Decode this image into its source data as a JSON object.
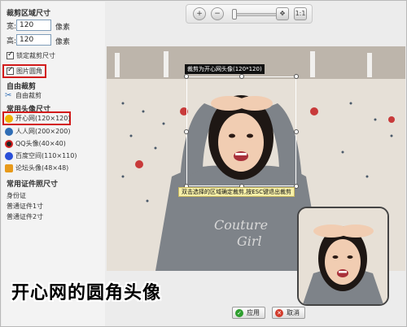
{
  "sidebar": {
    "crop_size_title": "裁剪区域尺寸",
    "width_label": "宽:",
    "width_value": "120",
    "width_unit": "像素",
    "height_label": "高:",
    "height_value": "120",
    "height_unit": "像素",
    "lock_size_label": "锁定裁剪尺寸",
    "rounded_corner_label": "图片圆角",
    "free_crop_title": "自由裁剪",
    "free_crop_item": "自由裁剪",
    "common_avatar_title": "常用头像尺寸",
    "avatar_items": [
      {
        "label": "开心网(120×120)",
        "icon": "kaixin-icon",
        "color": "#e8a400"
      },
      {
        "label": "人人网(200×200)",
        "icon": "renren-icon",
        "color": "#2f6db5"
      },
      {
        "label": "QQ头像(40×40)",
        "icon": "qq-penguin-icon",
        "color": "#d61f1f"
      },
      {
        "label": "百度空间(110×110)",
        "icon": "baidu-paw-icon",
        "color": "#2a4fd8"
      },
      {
        "label": "论坛头像(48×48)",
        "icon": "forum-handshake-icon",
        "color": "#e89a1a"
      }
    ],
    "common_id_title": "常用证件照尺寸",
    "id_items": [
      "身份证",
      "普通证件1寸",
      "普通证件2寸"
    ]
  },
  "toolbar": {
    "zoom_in_icon": "zoom-in-icon",
    "zoom_out_icon": "zoom-out-icon",
    "fit_icon": "fit-screen-icon",
    "actual_size_icon": "actual-size-icon"
  },
  "canvas": {
    "crop_label": "裁剪为开心网头像(120*120)",
    "crop_hint": "双击选择的区域确定裁剪,按ESC键退出裁剪",
    "caption": "开心网的圆角头像"
  },
  "buttons": {
    "apply_label": "应用",
    "cancel_label": "取消"
  },
  "colors": {
    "highlight_red": "#d21a1a",
    "apply_green": "#2e9e2e",
    "cancel_red": "#d23b2b"
  }
}
